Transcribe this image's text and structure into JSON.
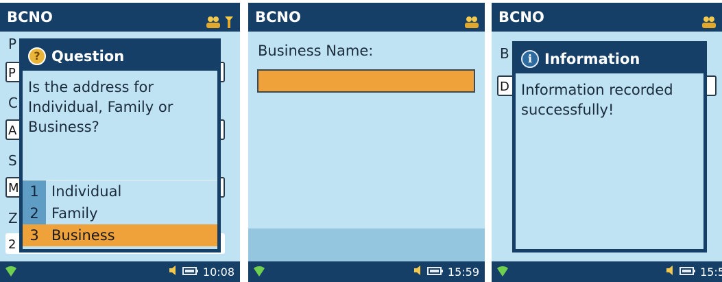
{
  "screens": [
    {
      "title": "BCNO",
      "background_labels": [
        "P",
        "C",
        "S",
        "Z"
      ],
      "background_values": [
        "P",
        "A",
        "M",
        "2"
      ],
      "dialog": {
        "title": "Question",
        "message": "Is the address for Individual, Family or Business?",
        "options": [
          {
            "num": "1",
            "label": "Individual",
            "selected": false
          },
          {
            "num": "2",
            "label": "Family",
            "selected": false
          },
          {
            "num": "3",
            "label": "Business",
            "selected": true
          }
        ]
      },
      "time": "10:08"
    },
    {
      "title": "BCNO",
      "field_label": "Business Name:",
      "field_value": "",
      "time": "15:59"
    },
    {
      "title": "BCNO",
      "background_labels": [
        "B"
      ],
      "background_values": [
        "D"
      ],
      "dialog": {
        "title": "Information",
        "message": "Information recorded successfully!"
      },
      "time": "15:5"
    }
  ],
  "colors": {
    "title_bar": "#163f68",
    "screen_bg": "#bfe3f3",
    "selected_highlight": "#f0a23a",
    "option_number_bg": "#5f9dc5"
  },
  "icons": [
    "people-icon",
    "tools-icon",
    "question-icon",
    "info-icon",
    "signal-icon",
    "speaker-icon",
    "battery-icon"
  ]
}
